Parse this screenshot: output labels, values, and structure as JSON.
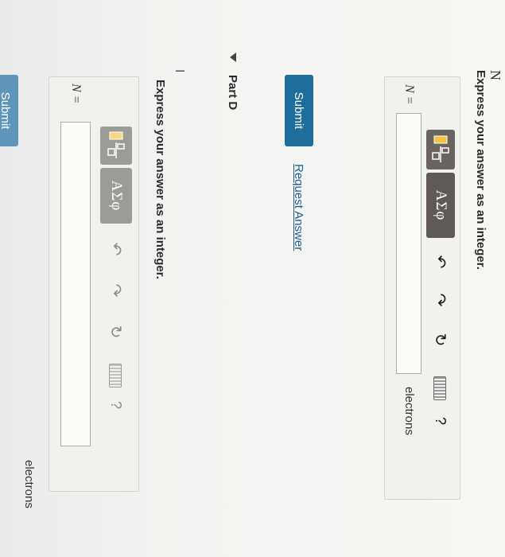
{
  "header": {
    "symbol": "N"
  },
  "part_c": {
    "prompt": "Express your answer as an integer.",
    "toolbar": {
      "template_icon": "fraction-template-icon",
      "greek_label": "ΑΣφ",
      "undo_icon": "undo-arrow-icon",
      "redo_icon": "redo-arrow-icon",
      "reset_icon": "reset-icon",
      "keyboard_icon": "keyboard-icon",
      "help_label": "?"
    },
    "answer": {
      "variable": "N =",
      "value": "",
      "unit": "electrons"
    },
    "submit_label": "Submit",
    "request_label": "Request Answer"
  },
  "part_d": {
    "title": "Part D",
    "collapse_icon": "triangle-down-icon",
    "cursor_text": "I",
    "prompt": "Express your answer as an integer.",
    "toolbar": {
      "greek_label": "ΑΣφ",
      "help_label": "?"
    },
    "answer": {
      "variable": "N =",
      "value": "",
      "unit": "electrons"
    },
    "submit_label": "Submit"
  },
  "colors": {
    "submit": "#1f6d9a",
    "link": "#1d5f92",
    "toolbar": "#6a6460"
  }
}
